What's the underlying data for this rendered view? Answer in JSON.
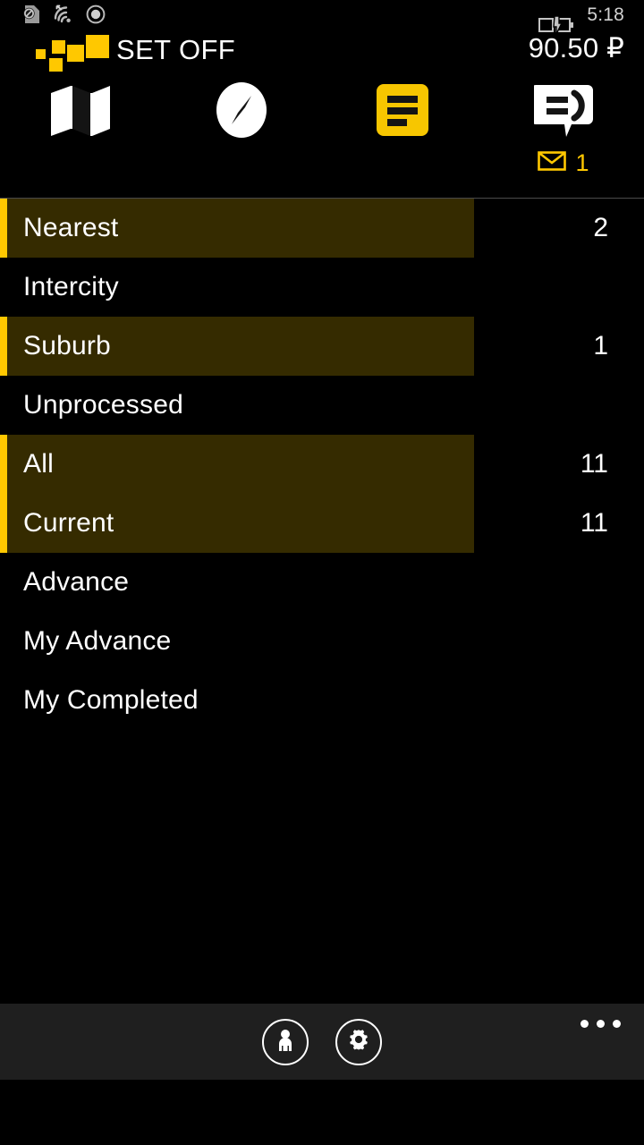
{
  "status_bar": {
    "icons": [
      "no-sim-icon",
      "wifi-icon",
      "record-circle-icon"
    ],
    "battery_icon": "battery-charging-icon",
    "clock": "5:18"
  },
  "header": {
    "logo_icon": "set-off-squares-logo",
    "title": "SET OFF",
    "balance": "90.50 ₽",
    "accent_color": "#ffc800"
  },
  "nav": {
    "items": [
      {
        "id": "map",
        "icon": "map-icon",
        "label": "Map",
        "active": false
      },
      {
        "id": "compass",
        "icon": "compass-icon",
        "label": "Compass",
        "active": false
      },
      {
        "id": "orders",
        "icon": "list-icon",
        "label": "Orders",
        "active": true
      },
      {
        "id": "chat",
        "icon": "chat-icon",
        "label": "Chat",
        "active": false
      }
    ],
    "chat_badge": {
      "icon": "envelope-icon",
      "count": "1"
    }
  },
  "filter_list": {
    "groups": [
      {
        "highlight": true,
        "rows": [
          {
            "label": "Nearest",
            "count": "2"
          }
        ]
      },
      {
        "highlight": false,
        "rows": [
          {
            "label": "Intercity",
            "count": ""
          }
        ]
      },
      {
        "highlight": true,
        "rows": [
          {
            "label": "Suburb",
            "count": "1"
          }
        ]
      },
      {
        "highlight": false,
        "rows": [
          {
            "label": "Unprocessed",
            "count": ""
          }
        ]
      },
      {
        "highlight": true,
        "rows": [
          {
            "label": "All",
            "count": "11"
          },
          {
            "label": "Current",
            "count": "11"
          }
        ]
      },
      {
        "highlight": false,
        "rows": [
          {
            "label": "Advance",
            "count": ""
          }
        ]
      },
      {
        "highlight": false,
        "rows": [
          {
            "label": "My Advance",
            "count": ""
          }
        ]
      },
      {
        "highlight": false,
        "rows": [
          {
            "label": "My Completed",
            "count": ""
          }
        ]
      }
    ]
  },
  "app_bar": {
    "actions": [
      {
        "id": "profile",
        "icon": "person-icon",
        "label": "Profile"
      },
      {
        "id": "settings",
        "icon": "gear-icon",
        "label": "Settings"
      }
    ],
    "overflow_icon": "more-dots-icon"
  }
}
